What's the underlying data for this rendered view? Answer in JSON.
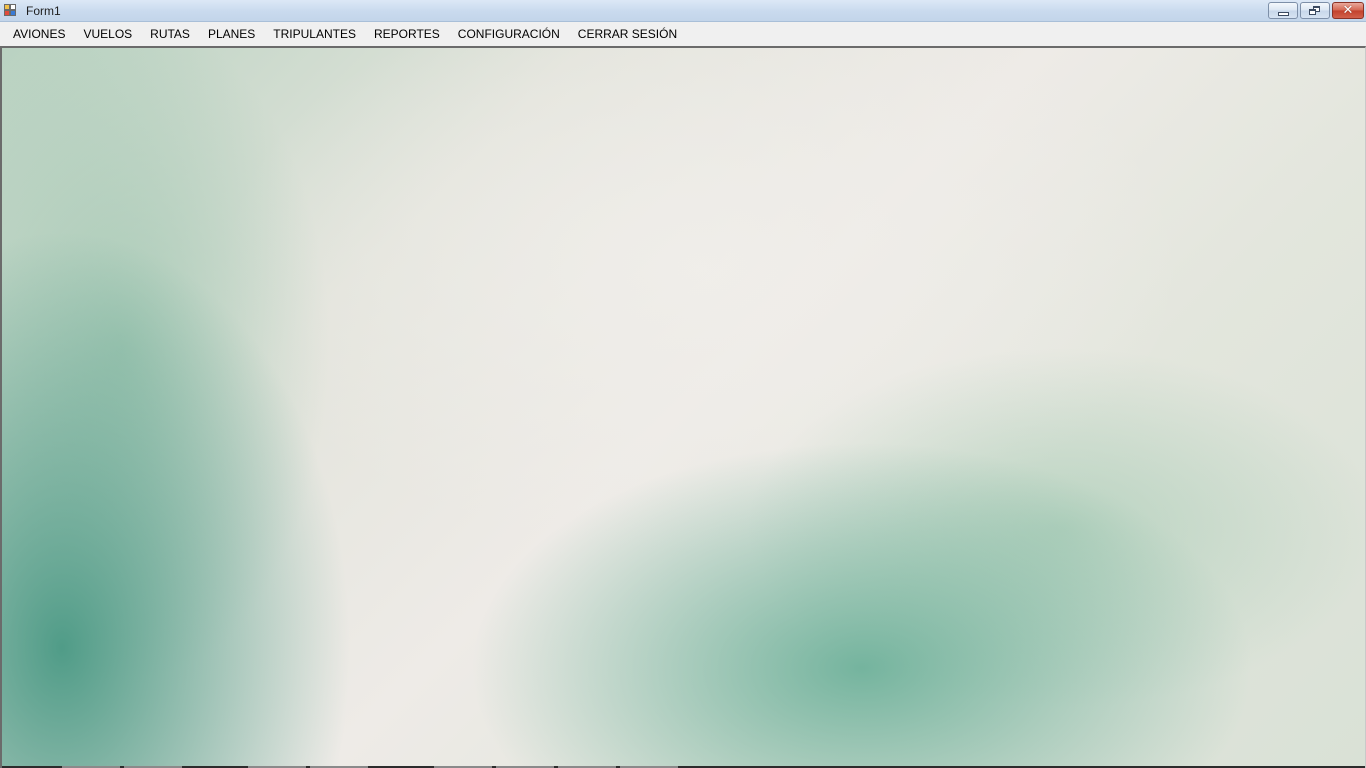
{
  "window": {
    "title": "Form1",
    "icon": "winforms-app-icon",
    "controls": {
      "minimize": "minimize-icon",
      "restore": "restore-icon",
      "close": "close-icon",
      "close_glyph": "✕"
    }
  },
  "menu": {
    "items": [
      "AVIONES",
      "VUELOS",
      "RUTAS",
      "PLANES",
      "TRIPULANTES",
      "REPORTES",
      "CONFIGURACIÓN",
      "CERRAR SESIÓN"
    ]
  },
  "colors": {
    "titlebar": "#c9daee",
    "menubar": "#f0f0f0",
    "close_button": "#c2412c",
    "background_teal": "#489883",
    "background_light": "#eeebe7"
  }
}
